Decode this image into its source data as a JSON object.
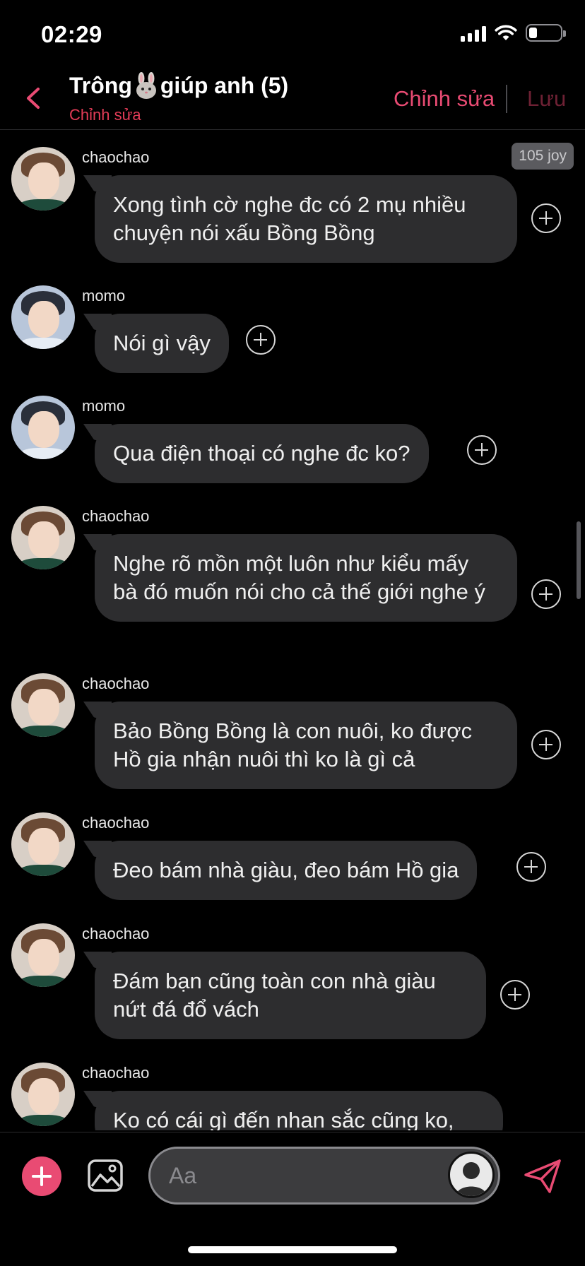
{
  "status_bar": {
    "time": "02:29",
    "battery_level": 0.25
  },
  "header": {
    "back_icon": "chevron-left-icon",
    "title_prefix": "Trông",
    "title_icon": "rabbit-icon",
    "title_suffix": "giúp anh (5)",
    "subtitle": "Chỉnh sửa",
    "edit_label": "Chỉnh sửa",
    "save_label": "Lưu",
    "accent_color": "#e94b73"
  },
  "chat": {
    "joy_badge": "105 joy",
    "messages": [
      {
        "sender": "chaochao",
        "text": "Xong tình cờ nghe đc có 2 mụ nhiều chuyện nói xấu Bồng Bồng"
      },
      {
        "sender": "momo",
        "text": "Nói gì vậy"
      },
      {
        "sender": "momo",
        "text": "Qua điện thoại có nghe đc ko?"
      },
      {
        "sender": "chaochao",
        "text": "Nghe rõ mồn một luôn như kiểu mấy bà đó muốn nói cho cả thế giới nghe ý"
      },
      {
        "sender": "chaochao",
        "text": "Bảo Bồng Bồng là con nuôi, ko được Hồ gia nhận nuôi thì ko là gì cả"
      },
      {
        "sender": "chaochao",
        "text": "Đeo bám nhà giàu, đeo bám Hồ gia"
      },
      {
        "sender": "chaochao",
        "text": "Đám bạn cũng toàn con nhà giàu nứt đá đổ vách"
      },
      {
        "sender": "chaochao",
        "text": "Ko có cái gì đến nhan sắc cũng ko,"
      }
    ]
  },
  "input_bar": {
    "placeholder": "Aa",
    "add_icon": "plus-circle-icon",
    "image_icon": "image-icon",
    "send_icon": "send-icon"
  }
}
